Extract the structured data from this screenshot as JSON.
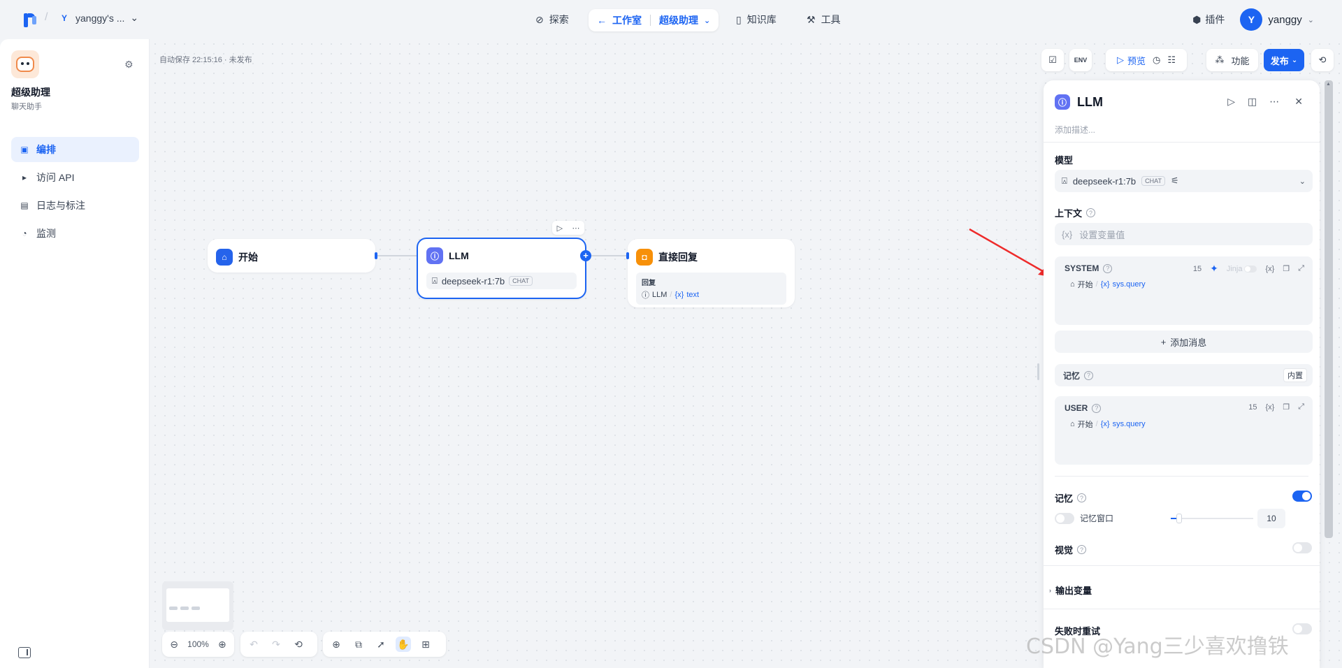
{
  "topbar": {
    "workspace_initial": "Y",
    "workspace_name": "yanggy's ...",
    "nav_explore": "探索",
    "nav_studio": "工作室",
    "nav_app": "超级助理",
    "nav_knowledge": "知识库",
    "nav_tools": "工具",
    "plugins": "插件",
    "user_initial": "Y",
    "user_name": "yanggy"
  },
  "sidebar": {
    "app_name": "超级助理",
    "app_type": "聊天助手",
    "items": [
      {
        "label": "编排",
        "icon": "layout-icon",
        "active": true
      },
      {
        "label": "访问 API",
        "icon": "terminal-icon",
        "active": false
      },
      {
        "label": "日志与标注",
        "icon": "document-icon",
        "active": false
      },
      {
        "label": "监测",
        "icon": "gauge-icon",
        "active": false
      }
    ]
  },
  "canvas": {
    "autosave": "自动保存 22:15:16 · 未发布",
    "zoom": "100%",
    "nodes": {
      "start": {
        "title": "开始"
      },
      "llm": {
        "title": "LLM",
        "model": "deepseek-r1:7b",
        "badge": "CHAT"
      },
      "answer": {
        "title": "直接回复",
        "reply_label": "回复",
        "ref_node": "LLM",
        "ref_var": "text",
        "ref_var_prefix": "{x}"
      }
    }
  },
  "toolbar_right": {
    "env": "ENV",
    "preview": "预览",
    "features": "功能",
    "publish": "发布"
  },
  "panel": {
    "title": "LLM",
    "description_placeholder": "添加描述...",
    "model_label": "模型",
    "model_name": "deepseek-r1:7b",
    "model_badge": "CHAT",
    "context_label": "上下文",
    "context_placeholder": "设置变量值",
    "context_prefix": "{x}",
    "system": {
      "label": "SYSTEM",
      "count": "15",
      "jinja": "Jinja",
      "var_node": "开始",
      "var_prefix": "{x}",
      "var_name": "sys.query"
    },
    "add_message": "添加消息",
    "memory_builtin_label": "记忆",
    "memory_builtin_tag": "内置",
    "user": {
      "label": "USER",
      "count": "15",
      "var_node": "开始",
      "var_prefix": "{x}",
      "var_name": "sys.query"
    },
    "memory_label": "记忆",
    "memory_enabled": true,
    "memory_window_label": "记忆窗口",
    "memory_window_enabled": false,
    "memory_window_value": "10",
    "memory_window_fraction": 0.1,
    "vision_label": "视觉",
    "vision_enabled": false,
    "output_vars_label": "输出变量",
    "retry_label": "失败时重试",
    "retry_enabled": false
  },
  "watermark": "CSDN @Yang三少喜欢撸铁",
  "colors": {
    "accent": "#1c64f2",
    "start_icon": "#2563eb",
    "llm_icon": "#6172f3",
    "answer_icon": "#f79009",
    "arrow": "#ee2b2b"
  }
}
